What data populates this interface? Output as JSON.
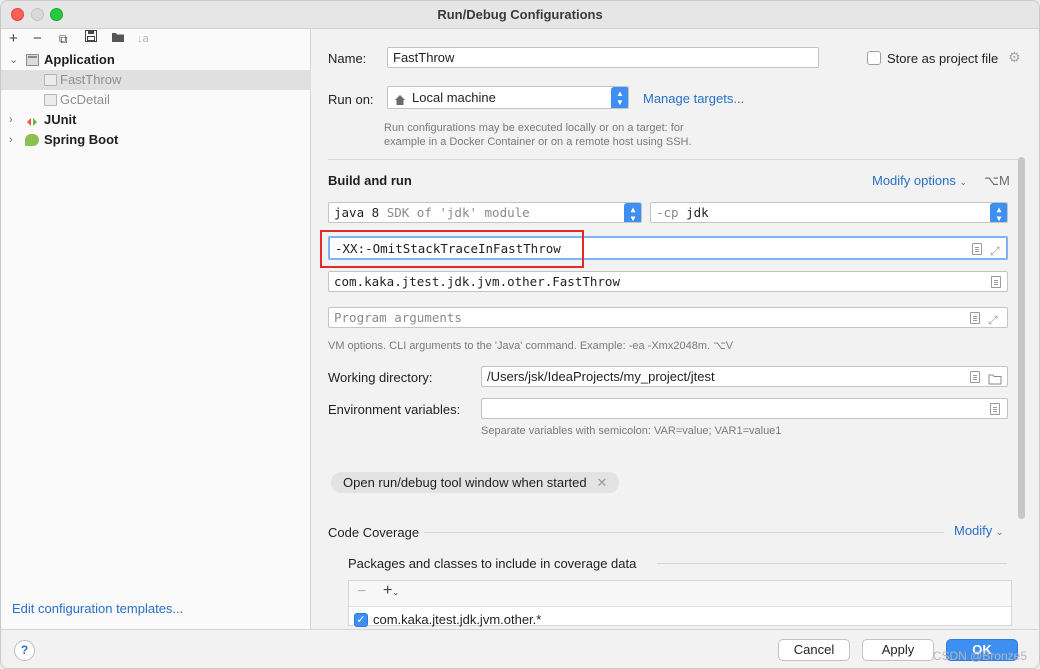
{
  "window": {
    "title": "Run/Debug Configurations"
  },
  "sidebar": {
    "toolbar": {
      "add": "+",
      "remove": "−",
      "copy": "⧉",
      "save": "💾",
      "folder": "📁",
      "sort": "↓a"
    },
    "tree": [
      {
        "label": "Application",
        "expanded": true,
        "children": [
          "FastThrow",
          "GcDetail"
        ]
      },
      {
        "label": "JUnit",
        "expanded": false
      },
      {
        "label": "Spring Boot",
        "expanded": false
      }
    ],
    "edit_templates": "Edit configuration templates..."
  },
  "form": {
    "name_label": "Name:",
    "name_value": "FastThrow",
    "store_label": "Store as project file",
    "run_on_label": "Run on:",
    "run_on_value": "Local machine",
    "manage_targets": "Manage targets...",
    "run_on_hint": "Run configurations may be executed locally or on a target: for example in a Docker Container or on a remote host using SSH.",
    "build_run_title": "Build and run",
    "modify_options": "Modify options",
    "modify_shortcut": "⌥M",
    "jdk_value": "java 8",
    "jdk_hint": "SDK of 'jdk' module",
    "cp_prefix": "-cp",
    "cp_value": "jdk",
    "vm_options_value": "-XX:-OmitStackTraceInFastThrow",
    "main_class_value": "com.kaka.jtest.jdk.jvm.other.FastThrow",
    "program_args_placeholder": "Program arguments",
    "vm_hint": "VM options. CLI arguments to the 'Java' command. Example: -ea -Xmx2048m. ⌥V",
    "working_dir_label": "Working directory:",
    "working_dir_value": "/Users/jsk/IdeaProjects/my_project/jtest",
    "env_label": "Environment variables:",
    "env_value": "",
    "env_hint": "Separate variables with semicolon: VAR=value; VAR1=value1",
    "open_tool_chip": "Open run/debug tool window when started",
    "code_coverage_title": "Code Coverage",
    "modify": "Modify",
    "packages_title": "Packages and classes to include in coverage data",
    "coverage_item": "com.kaka.jtest.jdk.jvm.other.*"
  },
  "buttons": {
    "cancel": "Cancel",
    "apply": "Apply",
    "ok": "OK",
    "help": "?"
  },
  "watermark": "CSDN @Bronze5",
  "colors": {
    "accent": "#3d8ff2",
    "link": "#2770c7",
    "highlight": "#e12b2b"
  }
}
